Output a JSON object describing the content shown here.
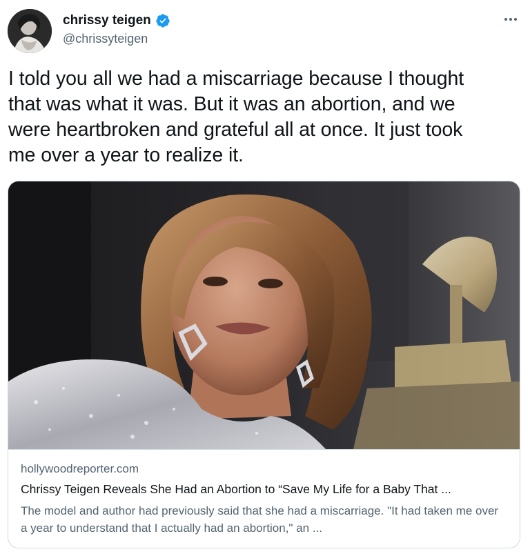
{
  "author": {
    "display_name": "chrissy teigen",
    "handle": "@chrissyteigen",
    "verified": true,
    "avatar_icon": "profile-photo"
  },
  "tweet": {
    "text": "I told you all we had a miscarriage because I thought\nthat was what it was. But it was an abortion, and we\nwere heartbroken and grateful all at once. It just took\nme over a year to realize it."
  },
  "card": {
    "image_icon": "article-photo",
    "domain": "hollywoodreporter.com",
    "title": "Chrissy Teigen Reveals She Had an Abortion to “Save My Life for a Baby That ...",
    "description": "The model and author had previously said that she had a miscarriage. \"It had taken me over a year to understand that I actually had an abortion,\" an ..."
  },
  "more_icon": "more-options-icon",
  "colors": {
    "verified": "#1d9bf0",
    "secondary_text": "#536471",
    "primary_text": "#0f1419",
    "border": "#cfd9de"
  }
}
